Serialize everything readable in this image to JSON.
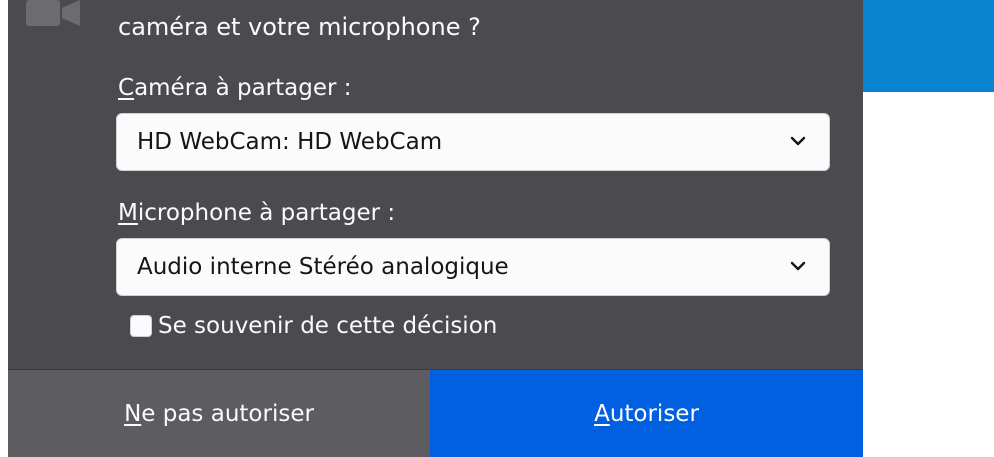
{
  "prompt": {
    "text": "caméra et votre microphone ?"
  },
  "camera": {
    "label_accesskey": "C",
    "label_rest": "améra à partager :",
    "selected": "HD WebCam: HD WebCam"
  },
  "microphone": {
    "label_accesskey": "M",
    "label_rest": "icrophone à partager :",
    "selected": "Audio interne Stéréo analogique"
  },
  "remember": {
    "label": "Se souvenir de cette décision",
    "checked": false
  },
  "buttons": {
    "deny_accesskey": "N",
    "deny_rest": "e pas autoriser",
    "allow_accesskey": "A",
    "allow_rest": "utoriser"
  },
  "colors": {
    "panel_background": "#4a4a4f",
    "deny_background": "#5c5c61",
    "allow_background": "#0060df",
    "page_banner": "#0a84d0"
  },
  "icons": {
    "prompt_icon": "camera-icon",
    "dropdown_icon": "chevron-down-icon"
  }
}
